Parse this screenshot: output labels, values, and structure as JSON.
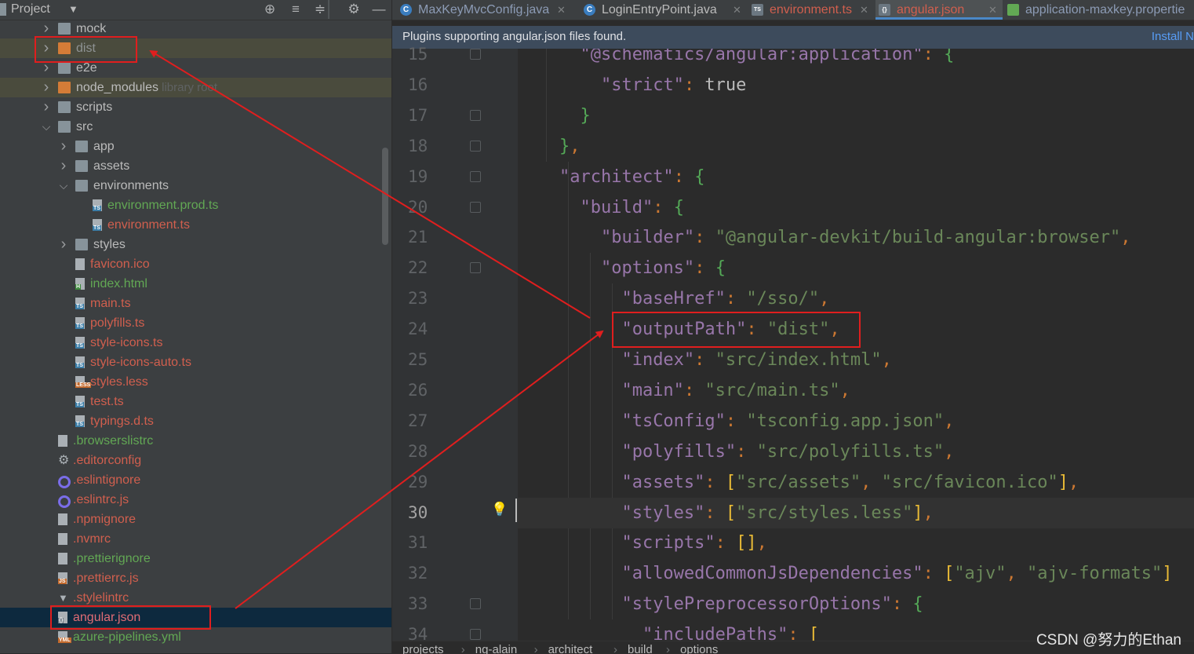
{
  "project_panel": {
    "title": "Project",
    "tree": [
      {
        "label": "mock",
        "kind": "folder",
        "depth": 0,
        "expanded": false,
        "color": "default"
      },
      {
        "label": "dist",
        "kind": "folder-orange",
        "depth": 0,
        "expanded": false,
        "color": "ignored"
      },
      {
        "label": "e2e",
        "kind": "folder",
        "depth": 0,
        "expanded": false,
        "color": "default"
      },
      {
        "label": "node_modules",
        "tag": "library root",
        "kind": "folder-orange",
        "depth": 0,
        "expanded": false,
        "color": "default"
      },
      {
        "label": "scripts",
        "kind": "folder",
        "depth": 0,
        "expanded": false,
        "color": "default"
      },
      {
        "label": "src",
        "kind": "folder",
        "depth": 0,
        "expanded": true,
        "color": "default"
      },
      {
        "label": "app",
        "kind": "folder",
        "depth": 1,
        "expanded": false,
        "color": "default"
      },
      {
        "label": "assets",
        "kind": "folder",
        "depth": 1,
        "expanded": false,
        "color": "default"
      },
      {
        "label": "environments",
        "kind": "folder",
        "depth": 1,
        "expanded": true,
        "color": "default"
      },
      {
        "label": "environment.prod.ts",
        "kind": "ts",
        "depth": 2,
        "color": "green"
      },
      {
        "label": "environment.ts",
        "kind": "ts",
        "depth": 2,
        "color": "red"
      },
      {
        "label": "styles",
        "kind": "folder",
        "depth": 1,
        "expanded": false,
        "color": "default"
      },
      {
        "label": "favicon.ico",
        "kind": "file",
        "depth": 1,
        "color": "red"
      },
      {
        "label": "index.html",
        "kind": "html",
        "depth": 1,
        "color": "green"
      },
      {
        "label": "main.ts",
        "kind": "ts",
        "depth": 1,
        "color": "red"
      },
      {
        "label": "polyfills.ts",
        "kind": "ts",
        "depth": 1,
        "color": "red"
      },
      {
        "label": "style-icons.ts",
        "kind": "ts",
        "depth": 1,
        "color": "red"
      },
      {
        "label": "style-icons-auto.ts",
        "kind": "ts",
        "depth": 1,
        "color": "red"
      },
      {
        "label": "styles.less",
        "kind": "less",
        "depth": 1,
        "color": "red"
      },
      {
        "label": "test.ts",
        "kind": "ts",
        "depth": 1,
        "color": "red"
      },
      {
        "label": "typings.d.ts",
        "kind": "ts",
        "depth": 1,
        "color": "red"
      },
      {
        "label": ".browserslistrc",
        "kind": "file",
        "depth": 0,
        "color": "green"
      },
      {
        "label": ".editorconfig",
        "kind": "gear",
        "depth": 0,
        "color": "red"
      },
      {
        "label": ".eslintignore",
        "kind": "eslint",
        "depth": 0,
        "color": "red"
      },
      {
        "label": ".eslintrc.js",
        "kind": "eslint",
        "depth": 0,
        "color": "red"
      },
      {
        "label": ".npmignore",
        "kind": "file",
        "depth": 0,
        "color": "red"
      },
      {
        "label": ".nvmrc",
        "kind": "file",
        "depth": 0,
        "color": "red"
      },
      {
        "label": ".prettierignore",
        "kind": "file",
        "depth": 0,
        "color": "green"
      },
      {
        "label": ".prettierrc.js",
        "kind": "js",
        "depth": 0,
        "color": "red"
      },
      {
        "label": ".stylelintrc",
        "kind": "stylelint",
        "depth": 0,
        "color": "red"
      },
      {
        "label": "angular.json",
        "kind": "json",
        "depth": 0,
        "color": "red",
        "selected": true
      },
      {
        "label": "azure-pipelines.yml",
        "kind": "yml",
        "depth": 0,
        "color": "green"
      }
    ]
  },
  "tabs": [
    {
      "label": "MaxKeyMvcConfig.java",
      "icon": "C",
      "color": "#8c9bb5",
      "active": false
    },
    {
      "label": "LoginEntryPoint.java",
      "icon": "C",
      "color": "#bbbbbb",
      "active": false
    },
    {
      "label": "environment.ts",
      "icon": "TS",
      "color": "#d15f4e",
      "active": false
    },
    {
      "label": "angular.json",
      "icon": "{}",
      "color": "#d15f4e",
      "active": true
    },
    {
      "label": "application-maxkey.propertie",
      "icon": "leaf",
      "color": "#8c9bb5",
      "active": false
    }
  ],
  "notification": {
    "text": "Plugins supporting angular.json files found.",
    "action": "Install N"
  },
  "editor": {
    "current_line": "30",
    "lines": [
      {
        "n": "15",
        "fold": true
      },
      {
        "n": "16",
        "fold": false
      },
      {
        "n": "17",
        "fold": true
      },
      {
        "n": "18",
        "fold": true
      },
      {
        "n": "19",
        "fold": true
      },
      {
        "n": "20",
        "fold": true
      },
      {
        "n": "21",
        "fold": false
      },
      {
        "n": "22",
        "fold": true
      },
      {
        "n": "23",
        "fold": false
      },
      {
        "n": "24",
        "fold": false
      },
      {
        "n": "25",
        "fold": false
      },
      {
        "n": "26",
        "fold": false
      },
      {
        "n": "27",
        "fold": false
      },
      {
        "n": "28",
        "fold": false
      },
      {
        "n": "29",
        "fold": false
      },
      {
        "n": "30",
        "fold": false
      },
      {
        "n": "31",
        "fold": false
      },
      {
        "n": "32",
        "fold": false
      },
      {
        "n": "33",
        "fold": true
      },
      {
        "n": "34",
        "fold": true
      }
    ],
    "code": [
      "      \"@schematics/angular:application\": {",
      "        \"strict\": true",
      "      }",
      "    },",
      "    \"architect\": {",
      "      \"build\": {",
      "        \"builder\": \"@angular-devkit/build-angular:browser\",",
      "        \"options\": {",
      "          \"baseHref\": \"/sso/\",",
      "          \"outputPath\": \"dist\",",
      "          \"index\": \"src/index.html\",",
      "          \"main\": \"src/main.ts\",",
      "          \"tsConfig\": \"tsconfig.app.json\",",
      "          \"polyfills\": \"src/polyfills.ts\",",
      "          \"assets\": [\"src/assets\", \"src/favicon.ico\"],",
      "          \"styles\": [\"src/styles.less\"],",
      "          \"scripts\": [],",
      "          \"allowedCommonJsDependencies\": [\"ajv\", \"ajv-formats\"]",
      "          \"stylePreprocessorOptions\": {",
      "            \"includePaths\": ["
    ]
  },
  "breadcrumbs": [
    "projects",
    "ng-alain",
    "architect",
    "build",
    "options"
  ],
  "watermark": "CSDN @努力的Ethan",
  "annotation_color": "#e01e1e"
}
